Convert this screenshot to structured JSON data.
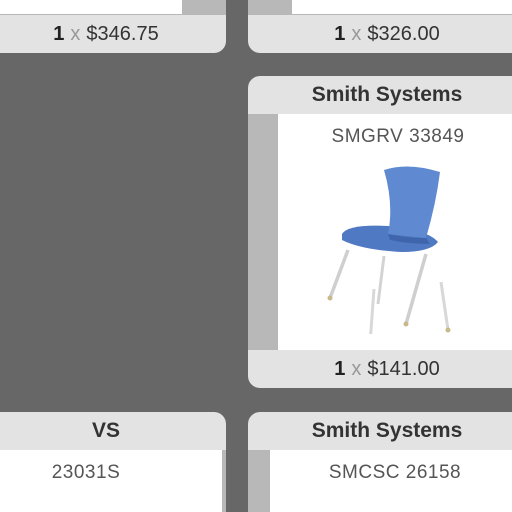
{
  "cards": {
    "top_left": {
      "qty": "1",
      "times": "x",
      "price": "$346.75"
    },
    "top_right": {
      "qty": "1",
      "times": "x",
      "price": "$326.00",
      "above_text": "1"
    },
    "middle_right": {
      "brand": "Smith Systems",
      "sku": "SMGRV 33849",
      "image": "blue-chair-image",
      "qty": "1",
      "times": "x",
      "price": "$141.00"
    },
    "bottom_left": {
      "brand": "VS",
      "sku": "23031S"
    },
    "bottom_right": {
      "brand": "Smith Systems",
      "sku": "SMCSC 26158"
    }
  },
  "colors": {
    "page_bg": "#676767",
    "bar_bg": "#e3e3e3",
    "frame": "#b8b8b8",
    "chair": "#5b86cc"
  }
}
